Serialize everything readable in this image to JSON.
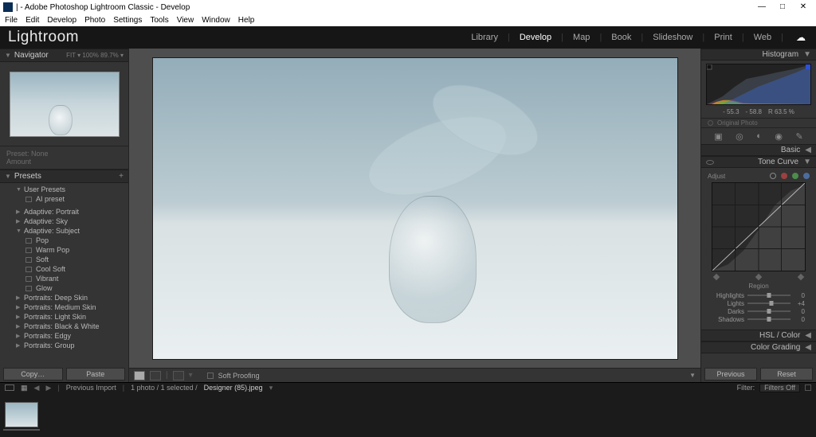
{
  "titlebar": {
    "text": "| - Adobe Photoshop Lightroom Classic - Develop"
  },
  "menubar": [
    "File",
    "Edit",
    "Develop",
    "Photo",
    "Settings",
    "Tools",
    "View",
    "Window",
    "Help"
  ],
  "logo": "Lightroom",
  "modules": [
    "Library",
    "Develop",
    "Map",
    "Book",
    "Slideshow",
    "Print",
    "Web"
  ],
  "modules_active": "Develop",
  "left": {
    "navigator_label": "Navigator",
    "nav_modes": "FIT ▾   100%   89.7% ▾",
    "preset_info_top": "Preset:  None",
    "preset_info_bot": "Amount",
    "presets_label": "Presets",
    "tree": [
      {
        "kind": "group-open",
        "label": "User Presets"
      },
      {
        "kind": "leaf",
        "label": "AI preset"
      },
      {
        "kind": "gap"
      },
      {
        "kind": "group",
        "label": "Adaptive: Portrait"
      },
      {
        "kind": "group",
        "label": "Adaptive: Sky"
      },
      {
        "kind": "group-open",
        "label": "Adaptive: Subject"
      },
      {
        "kind": "leaf",
        "label": "Pop"
      },
      {
        "kind": "leaf",
        "label": "Warm Pop"
      },
      {
        "kind": "leaf",
        "label": "Soft"
      },
      {
        "kind": "leaf",
        "label": "Cool Soft"
      },
      {
        "kind": "leaf",
        "label": "Vibrant"
      },
      {
        "kind": "leaf",
        "label": "Glow"
      },
      {
        "kind": "group",
        "label": "Portraits: Deep Skin"
      },
      {
        "kind": "group",
        "label": "Portraits: Medium Skin"
      },
      {
        "kind": "group",
        "label": "Portraits: Light Skin"
      },
      {
        "kind": "group",
        "label": "Portraits: Black & White"
      },
      {
        "kind": "group",
        "label": "Portraits: Edgy"
      },
      {
        "kind": "group",
        "label": "Portraits: Group"
      }
    ],
    "copy_label": "Copy…",
    "paste_label": "Paste"
  },
  "center": {
    "soft_proofing": "Soft Proofing"
  },
  "right": {
    "histogram_label": "Histogram",
    "hist_vals": [
      "- 55.3",
      "- 58.8",
      "R 63.5 %"
    ],
    "original_label": "Original Photo",
    "basic_label": "Basic",
    "tonecurve_label": "Tone Curve",
    "adjust_label": "Adjust",
    "region_label": "Region",
    "sliders": [
      {
        "name": "Highlights",
        "val": "0"
      },
      {
        "name": "Lights",
        "val": "+4"
      },
      {
        "name": "Darks",
        "val": "0"
      },
      {
        "name": "Shadows",
        "val": "0"
      }
    ],
    "hsl_label": "HSL / Color",
    "colorgrading_label": "Color Grading",
    "previous_label": "Previous",
    "reset_label": "Reset"
  },
  "infobar": {
    "prev_import": "Previous Import",
    "count": "1 photo / 1 selected /",
    "file": "Designer (85).jpeg",
    "filter": "Filter:",
    "filters_off": "Filters Off"
  }
}
